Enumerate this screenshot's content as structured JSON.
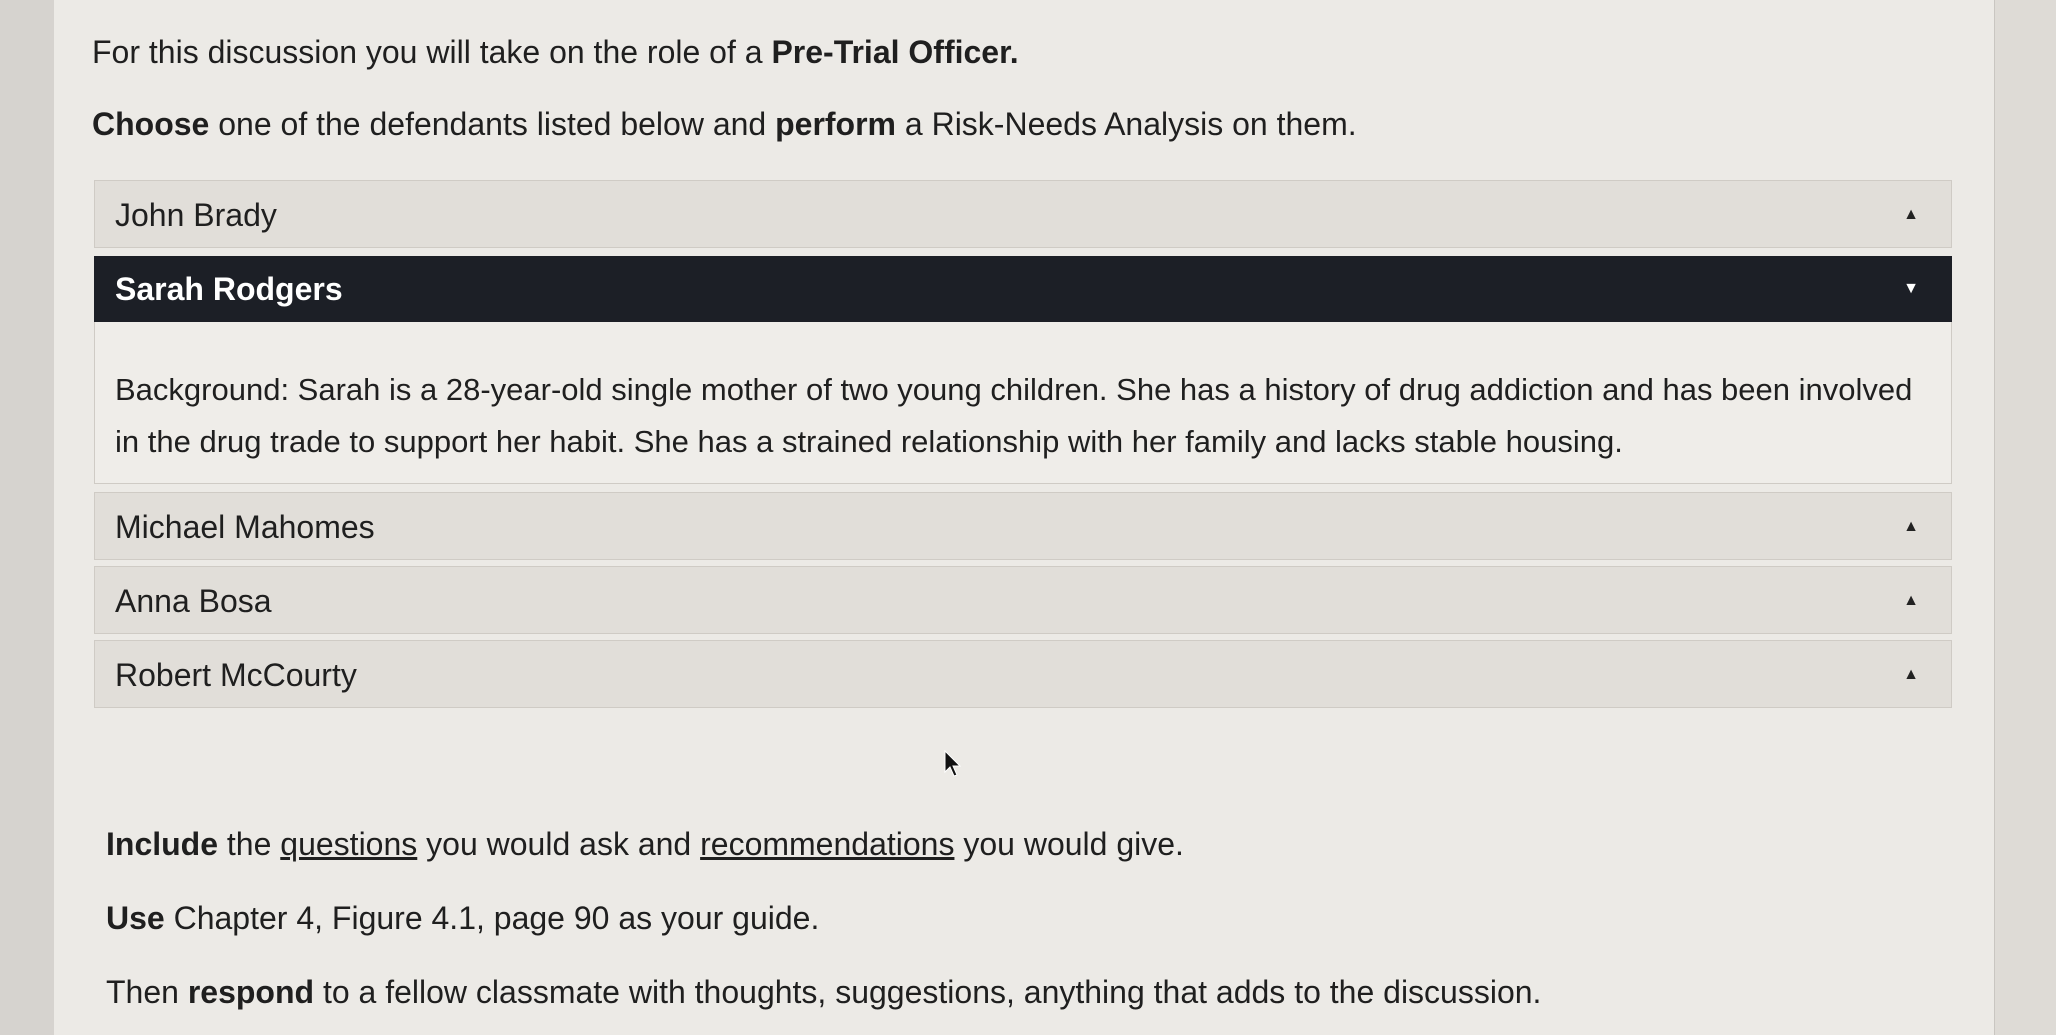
{
  "intro": {
    "prefix": "For this discussion you will take on the role of a ",
    "role": "Pre-Trial Officer."
  },
  "instruction": {
    "choose_word": "Choose",
    "middle": " one of the defendants listed below and ",
    "perform_word": "perform",
    "suffix": " a Risk-Needs Analysis on them."
  },
  "accordion": [
    {
      "name": "John Brady",
      "expanded": false
    },
    {
      "name": "Sarah Rodgers",
      "expanded": true
    },
    {
      "name": "Michael Mahomes",
      "expanded": false
    },
    {
      "name": "Anna Bosa",
      "expanded": false
    },
    {
      "name": "Robert McCourty",
      "expanded": false
    }
  ],
  "sarah_background": "Background: Sarah is a 28-year-old single mother of two young children. She has a history of drug addiction and has been involved in the drug trade to support her habit. She has a strained relationship with her family and lacks stable housing.",
  "icons": {
    "collapsed": "chevron-up-icon",
    "expanded": "chevron-down-icon",
    "cursor": "mouse-pointer-icon"
  },
  "footer": {
    "include_word": "Include",
    "include_a": " the ",
    "questions": "questions",
    "include_b": " you would ask and ",
    "recommendations": "recommendations",
    "include_c": " you would give.",
    "use_word": "Use",
    "use_rest": " Chapter 4, Figure 4.1, page 90 as your guide.",
    "then": "Then ",
    "respond_word": "respond",
    "respond_rest": " to a fellow classmate with thoughts, suggestions, anything that adds to the discussion."
  },
  "colors": {
    "active_header_bg": "#1c1f26",
    "header_bg": "#e1ded9",
    "page_bg": "#eceae6"
  }
}
